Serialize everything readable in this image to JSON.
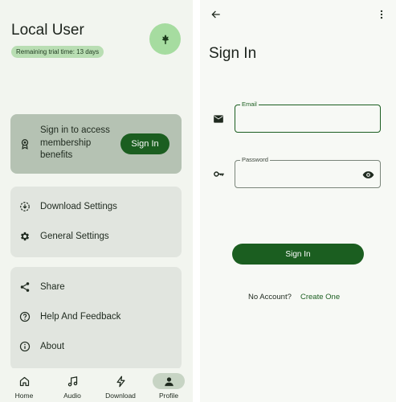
{
  "profile": {
    "title": "Local User",
    "trial_text": "Remaining trial time: 13 days",
    "avatar_icon": "flower-icon"
  },
  "signin_card": {
    "message": "Sign in to access membership benefits",
    "button": "Sign In",
    "icon": "badge-icon"
  },
  "settings": [
    {
      "label": "Download Settings",
      "icon": "download-settings-icon"
    },
    {
      "label": "General Settings",
      "icon": "gear-icon"
    }
  ],
  "more": [
    {
      "label": "Share",
      "icon": "share-icon"
    },
    {
      "label": "Help And Feedback",
      "icon": "help-icon"
    },
    {
      "label": "About",
      "icon": "info-icon"
    }
  ],
  "nav": [
    {
      "label": "Home",
      "icon": "home-icon"
    },
    {
      "label": "Audio",
      "icon": "music-note-icon"
    },
    {
      "label": "Download",
      "icon": "lightning-icon"
    },
    {
      "label": "Profile",
      "icon": "person-icon",
      "active": true
    }
  ],
  "signin_screen": {
    "title": "Sign In",
    "email_label": "Email",
    "email_value": "",
    "password_label": "Password",
    "password_value": "",
    "button": "Sign In",
    "no_account": "No Account?",
    "create_link": "Create One"
  },
  "colors": {
    "accent": "#1b5e20",
    "avatar_bg": "#a6dca0",
    "card_highlight": "#b5c2b3",
    "card_bg": "#e1e5df"
  }
}
